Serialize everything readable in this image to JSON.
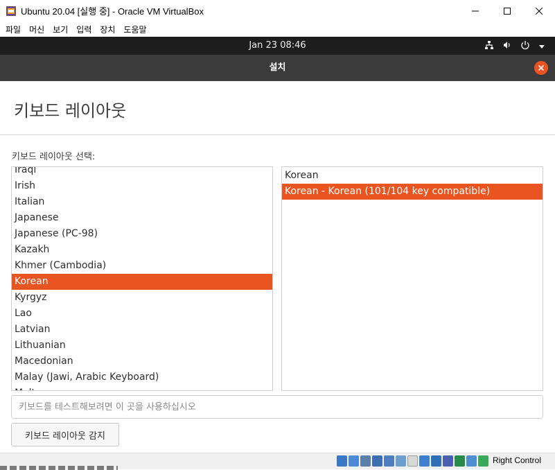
{
  "window": {
    "title": "Ubuntu 20.04 [실행 중] - Oracle VM VirtualBox",
    "menu": [
      "파일",
      "머신",
      "보기",
      "입력",
      "장치",
      "도움말"
    ]
  },
  "topbar": {
    "clock": "Jan 23  08:46",
    "icons": [
      "network-icon",
      "volume-icon",
      "power-icon",
      "dropdown-icon"
    ]
  },
  "installer": {
    "title": "설치",
    "page_title": "키보드 레이아웃",
    "select_label": "키보드 레이아웃 선택:",
    "layouts": [
      "Iraqi",
      "Irish",
      "Italian",
      "Japanese",
      "Japanese (PC-98)",
      "Kazakh",
      "Khmer (Cambodia)",
      "Korean",
      "Kyrgyz",
      "Lao",
      "Latvian",
      "Lithuanian",
      "Macedonian",
      "Malay (Jawi, Arabic Keyboard)",
      "Malt"
    ],
    "selected_layout": "Korean",
    "variants": [
      "Korean",
      "Korean - Korean (101/104 key compatible)"
    ],
    "selected_variant": "Korean - Korean (101/104 key compatible)",
    "test_placeholder": "키보드를 테스트해보려면 이 곳을 사용하십시오",
    "detect_button": "키보드 레이아웃 감지"
  },
  "statusbar": {
    "host_key": "Right Control"
  },
  "colors": {
    "accent": "#e95420",
    "header_bg": "#3b3b3b",
    "topbar_bg": "#1d1d1d"
  }
}
